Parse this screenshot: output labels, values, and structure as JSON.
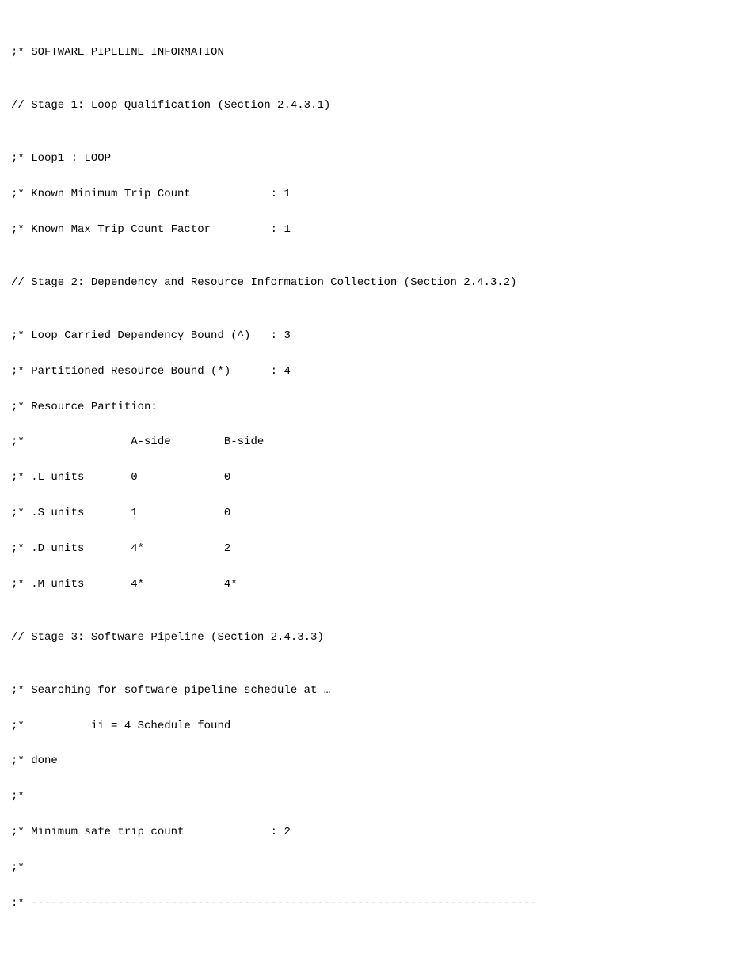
{
  "lines": {
    "l01": ";* SOFTWARE PIPELINE INFORMATION",
    "l02": "",
    "l03": "// Stage 1: Loop Qualification (Section 2.4.3.1)",
    "l04": "",
    "l05": ";* Loop1 : LOOP",
    "l06": ";* Known Minimum Trip Count            : 1",
    "l07": ";* Known Max Trip Count Factor         : 1",
    "l08": "",
    "l09": "// Stage 2: Dependency and Resource Information Collection (Section 2.4.3.2)",
    "l10": "",
    "l11": ";* Loop Carried Dependency Bound (^)   : 3",
    "l12": ";* Partitioned Resource Bound (*)      : 4",
    "l13": ";* Resource Partition:",
    "l14": ";*                A-side        B-side",
    "l15": ";* .L units       0             0",
    "l16": ";* .S units       1             0",
    "l17": ";* .D units       4*            2",
    "l18": ";* .M units       4*            4*",
    "l19": "",
    "l20": "// Stage 3: Software Pipeline (Section 2.4.3.3)",
    "l21": "",
    "l22": ";* Searching for software pipeline schedule at …",
    "l23": ";*          ii = 4 Schedule found",
    "l24": ";* done",
    "l25": ";*",
    "l26": ";* Minimum safe trip count             : 2",
    "l27": ";*",
    "l28": ":* ----------------------------------------------------------------------------"
  }
}
